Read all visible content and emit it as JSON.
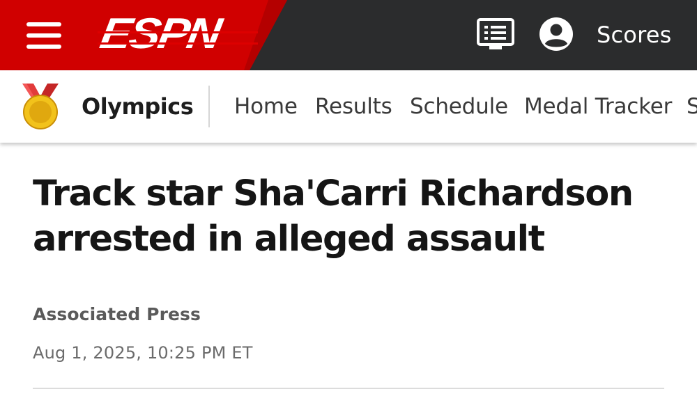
{
  "header": {
    "logo_text": "ESPN",
    "menu_icon": "hamburger-menu-icon",
    "feed_icon": "news-feed-icon",
    "profile_icon": "user-profile-icon",
    "scores_label": "Scores",
    "colors": {
      "brand_red": "#D00000",
      "bar_dark": "#2B2C2D"
    }
  },
  "subnav": {
    "icon": "gold-medal-icon",
    "section_title": "Olympics",
    "links": [
      "Home",
      "Results",
      "Schedule",
      "Medal Tracker",
      "S"
    ]
  },
  "article": {
    "headline": "Track star Sha'Carri Richardson arrested in alleged assault",
    "byline": "Associated Press",
    "timestamp": "Aug 1, 2025, 10:25 PM ET"
  }
}
